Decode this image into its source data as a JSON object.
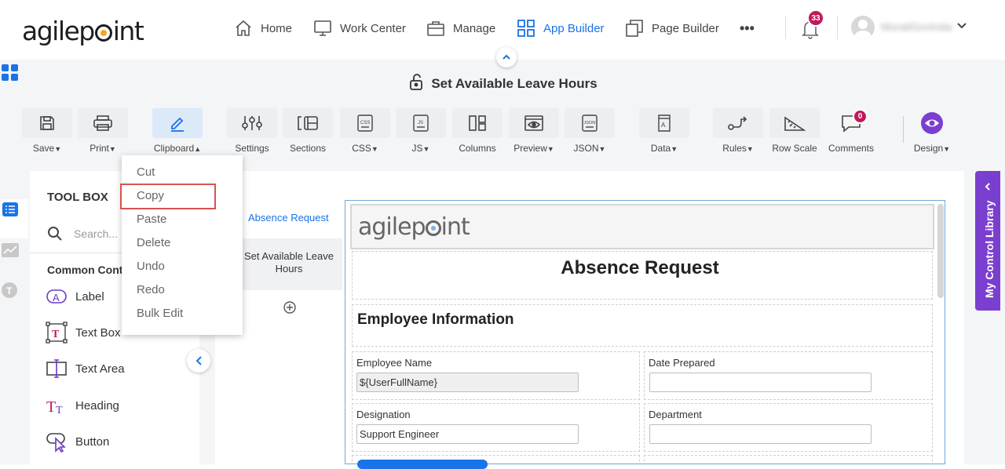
{
  "header": {
    "logo": "agilepoint",
    "nav": [
      {
        "label": "Home"
      },
      {
        "label": "Work Center"
      },
      {
        "label": "Manage"
      },
      {
        "label": "App Builder"
      },
      {
        "label": "Page Builder"
      }
    ],
    "more": "•••",
    "notifications": "33",
    "user_name": "MuraliGovinda"
  },
  "title_bar": {
    "title": "Set Available Leave Hours"
  },
  "ribbon": [
    {
      "label": "Save",
      "caret": true
    },
    {
      "label": "Print",
      "caret": true
    },
    {
      "label": "Clipboard",
      "caret": true
    },
    {
      "label": "Settings"
    },
    {
      "label": "Sections"
    },
    {
      "label": "CSS",
      "caret": true
    },
    {
      "label": "JS",
      "caret": true
    },
    {
      "label": "Columns"
    },
    {
      "label": "Preview",
      "caret": true
    },
    {
      "label": "JSON",
      "caret": true
    },
    {
      "label": "Data",
      "caret": true
    },
    {
      "label": "Rules",
      "caret": true
    },
    {
      "label": "Row Scale"
    },
    {
      "label": "Comments"
    },
    {
      "label": "Design",
      "caret": true
    }
  ],
  "comments_badge": "0",
  "clipboard_menu": [
    "Cut",
    "Copy",
    "Paste",
    "Delete",
    "Undo",
    "Redo",
    "Bulk Edit"
  ],
  "toolbox": {
    "title": "TOOL BOX",
    "search_placeholder": "Search...",
    "section": "Common Cont",
    "items": [
      "Label",
      "Text Box",
      "Text Area",
      "Heading",
      "Button"
    ]
  },
  "pages": {
    "link": "Absence Request",
    "current": "Set Available Leave Hours"
  },
  "form": {
    "logo": "agilepoint",
    "title": "Absence Request",
    "section": "Employee Information",
    "fields": [
      {
        "label": "Employee Name",
        "value": "${UserFullName}"
      },
      {
        "label": "Date Prepared",
        "value": ""
      },
      {
        "label": "Designation",
        "value": "Support Engineer"
      },
      {
        "label": "Department",
        "value": ""
      }
    ]
  },
  "right_panel": {
    "label": "My Control Library"
  },
  "colors": {
    "accent": "#1a73e8",
    "purple": "#7b3fd0",
    "badge": "#c2185b",
    "highlight": "#d9534f"
  }
}
